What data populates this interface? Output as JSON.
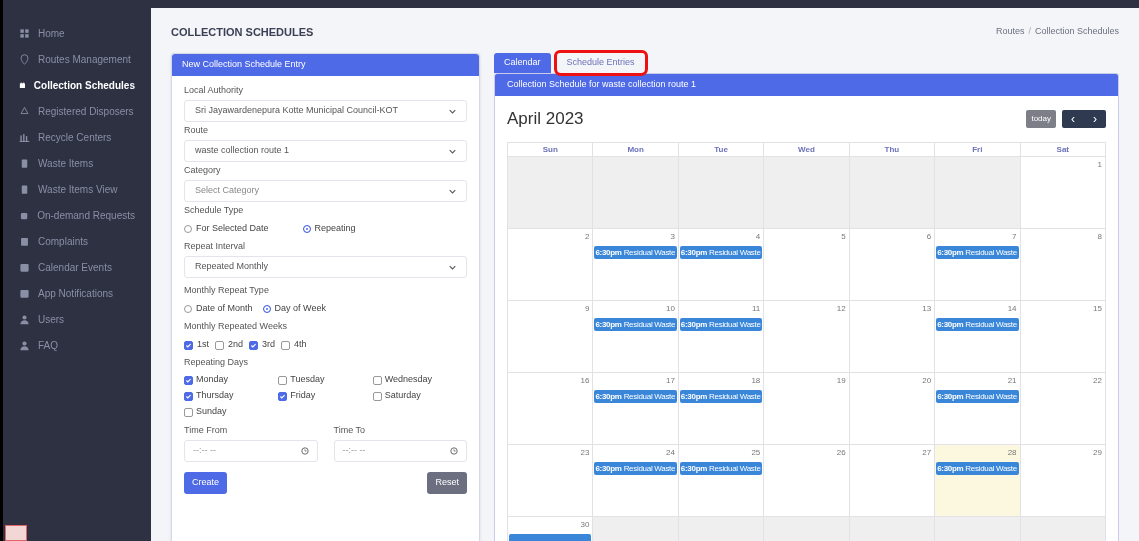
{
  "sidebar": {
    "items": [
      {
        "label": "Home",
        "selected": false
      },
      {
        "label": "Routes Management",
        "selected": false
      },
      {
        "label": "Collection Schedules",
        "selected": true
      },
      {
        "label": "Registered Disposers",
        "selected": false
      },
      {
        "label": "Recycle Centers",
        "selected": false
      },
      {
        "label": "Waste Items",
        "selected": false
      },
      {
        "label": "Waste Items View",
        "selected": false
      },
      {
        "label": "On-demand Requests",
        "selected": false
      },
      {
        "label": "Complaints",
        "selected": false
      },
      {
        "label": "Calendar Events",
        "selected": false
      },
      {
        "label": "App Notifications",
        "selected": false
      },
      {
        "label": "Users",
        "selected": false
      },
      {
        "label": "FAQ",
        "selected": false
      }
    ]
  },
  "page_title": "COLLECTION SCHEDULES",
  "breadcrumb": [
    "Routes",
    "Collection Schedules"
  ],
  "breadcrumb_separator": "/",
  "form": {
    "title": "New Collection Schedule Entry",
    "local_authority": {
      "label": "Local Authority",
      "value": "Sri Jayawardenepura Kotte Municipal Council-KOT"
    },
    "route": {
      "label": "Route",
      "value": "waste collection route 1"
    },
    "category": {
      "label": "Category",
      "placeholder": "Select Category"
    },
    "schedule_type": {
      "label": "Schedule Type",
      "options": [
        {
          "label": "For Selected Date",
          "selected": false
        },
        {
          "label": "Repeating",
          "selected": true
        }
      ]
    },
    "repeat_interval": {
      "label": "Repeat Interval",
      "value": "Repeated Monthly"
    },
    "monthly_repeat_type": {
      "label": "Monthly Repeat Type",
      "options": [
        {
          "label": "Date of Month",
          "selected": false
        },
        {
          "label": "Day of Week",
          "selected": true
        }
      ]
    },
    "monthly_repeated_weeks": {
      "label": "Monthly Repeated Weeks",
      "options": [
        {
          "label": "1st",
          "checked": true
        },
        {
          "label": "2nd",
          "checked": false
        },
        {
          "label": "3rd",
          "checked": true
        },
        {
          "label": "4th",
          "checked": false
        }
      ]
    },
    "repeating_days": {
      "label": "Repeating Days",
      "options": [
        {
          "label": "Monday",
          "checked": true
        },
        {
          "label": "Tuesday",
          "checked": false
        },
        {
          "label": "Wednesday",
          "checked": false
        },
        {
          "label": "Thursday",
          "checked": true
        },
        {
          "label": "Friday",
          "checked": true
        },
        {
          "label": "Saturday",
          "checked": false
        },
        {
          "label": "Sunday",
          "checked": false
        }
      ]
    },
    "time_from": {
      "label": "Time From",
      "placeholder": "--:-- --"
    },
    "time_to": {
      "label": "Time To",
      "placeholder": "--:-- --"
    },
    "buttons": [
      "Create",
      "Reset"
    ]
  },
  "tabs": [
    {
      "label": "Calendar",
      "selected": true,
      "highlighted": false
    },
    {
      "label": "Schedule Entries",
      "selected": false,
      "highlighted": true
    }
  ],
  "calendar": {
    "title": "Collection Schedule for waste collection route 1",
    "month": "April 2023",
    "today_button": "today",
    "prev": "‹",
    "next": "›",
    "weekdays": [
      "Sun",
      "Mon",
      "Tue",
      "Wed",
      "Thu",
      "Fri",
      "Sat"
    ],
    "weeks": [
      [
        {
          "other": true
        },
        {
          "other": true
        },
        {
          "other": true
        },
        {
          "other": true
        },
        {
          "other": true
        },
        {
          "other": true
        },
        {
          "day": "1",
          "other": false,
          "today": false
        }
      ],
      [
        {
          "day": "2",
          "other": false,
          "today": false
        },
        {
          "day": "3",
          "other": false,
          "today": false,
          "events": [
            {
              "time": "6:30pm",
              "title": "Residual Waste"
            }
          ]
        },
        {
          "day": "4",
          "other": false,
          "today": false,
          "events": [
            {
              "time": "6:30pm",
              "title": "Residual Waste"
            }
          ]
        },
        {
          "day": "5",
          "other": false,
          "today": false
        },
        {
          "day": "6",
          "other": false,
          "today": false
        },
        {
          "day": "7",
          "other": false,
          "today": false,
          "events": [
            {
              "time": "6:30pm",
              "title": "Residual Waste"
            }
          ]
        },
        {
          "day": "8",
          "other": false,
          "today": false
        }
      ],
      [
        {
          "day": "9",
          "other": false,
          "today": false
        },
        {
          "day": "10",
          "other": false,
          "today": false,
          "events": [
            {
              "time": "6:30pm",
              "title": "Residual Waste"
            }
          ]
        },
        {
          "day": "11",
          "other": false,
          "today": false,
          "events": [
            {
              "time": "6:30pm",
              "title": "Residual Waste"
            }
          ]
        },
        {
          "day": "12",
          "other": false,
          "today": false
        },
        {
          "day": "13",
          "other": false,
          "today": false
        },
        {
          "day": "14",
          "other": false,
          "today": false,
          "events": [
            {
              "time": "6:30pm",
              "title": "Residual Waste"
            }
          ]
        },
        {
          "day": "15",
          "other": false,
          "today": false
        }
      ],
      [
        {
          "day": "16",
          "other": false,
          "today": false
        },
        {
          "day": "17",
          "other": false,
          "today": false,
          "events": [
            {
              "time": "6:30pm",
              "title": "Residual Waste"
            }
          ]
        },
        {
          "day": "18",
          "other": false,
          "today": false,
          "events": [
            {
              "time": "6:30pm",
              "title": "Residual Waste"
            }
          ]
        },
        {
          "day": "19",
          "other": false,
          "today": false
        },
        {
          "day": "20",
          "other": false,
          "today": false
        },
        {
          "day": "21",
          "other": false,
          "today": false,
          "events": [
            {
              "time": "6:30pm",
              "title": "Residual Waste"
            }
          ]
        },
        {
          "day": "22",
          "other": false,
          "today": false
        }
      ],
      [
        {
          "day": "23",
          "other": false,
          "today": false
        },
        {
          "day": "24",
          "other": false,
          "today": false,
          "events": [
            {
              "time": "6:30pm",
              "title": "Residual Waste"
            }
          ]
        },
        {
          "day": "25",
          "other": false,
          "today": false,
          "events": [
            {
              "time": "6:30pm",
              "title": "Residual Waste"
            }
          ]
        },
        {
          "day": "26",
          "other": false,
          "today": false
        },
        {
          "day": "27",
          "other": false,
          "today": false
        },
        {
          "day": "28",
          "other": false,
          "today": true,
          "events": [
            {
              "time": "6:30pm",
              "title": "Residual Waste"
            }
          ]
        },
        {
          "day": "29",
          "other": false,
          "today": false
        }
      ],
      [
        {
          "day": "30",
          "other": false,
          "today": false,
          "event_hidden": true
        },
        {
          "other": true
        },
        {
          "other": true
        },
        {
          "other": true
        },
        {
          "other": true
        },
        {
          "other": true
        },
        {
          "other": true
        }
      ]
    ]
  }
}
